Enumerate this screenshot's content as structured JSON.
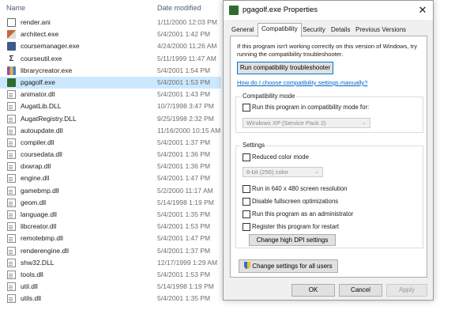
{
  "explorer": {
    "columns": {
      "name": "Name",
      "date": "Date modified"
    },
    "files": [
      {
        "name": "render.ani",
        "date": "1/11/2000 12:03 PM",
        "icon": "ani-file-icon"
      },
      {
        "name": "architect.exe",
        "date": "5/4/2001 1:42 PM",
        "icon": "architect-app-icon"
      },
      {
        "name": "coursemanager.exe",
        "date": "4/24/2000 11:26 AM",
        "icon": "coursemanager-app-icon"
      },
      {
        "name": "courseutil.exe",
        "date": "5/11/1999 11:47 AM",
        "icon": "courseutil-app-icon"
      },
      {
        "name": "librarycreator.exe",
        "date": "5/4/2001 1:54 PM",
        "icon": "librarycreator-app-icon"
      },
      {
        "name": "pgagolf.exe",
        "date": "5/4/2001 1:53 PM",
        "icon": "pgagolf-app-icon",
        "selected": true
      },
      {
        "name": "animator.dll",
        "date": "5/4/2001 1:43 PM",
        "icon": "dll-file-icon"
      },
      {
        "name": "AugatLib.DLL",
        "date": "10/7/1998 3:47 PM",
        "icon": "dll-file-icon"
      },
      {
        "name": "AugatRegistry.DLL",
        "date": "9/25/1998 2:32 PM",
        "icon": "dll-file-icon"
      },
      {
        "name": "autoupdate.dll",
        "date": "11/16/2000 10:15 AM",
        "icon": "dll-file-icon"
      },
      {
        "name": "compiler.dll",
        "date": "5/4/2001 1:37 PM",
        "icon": "dll-file-icon"
      },
      {
        "name": "coursedata.dll",
        "date": "5/4/2001 1:36 PM",
        "icon": "dll-file-icon"
      },
      {
        "name": "dxwrap.dll",
        "date": "5/4/2001 1:36 PM",
        "icon": "dll-file-icon"
      },
      {
        "name": "engine.dll",
        "date": "5/4/2001 1:47 PM",
        "icon": "dll-file-icon"
      },
      {
        "name": "gamebmp.dll",
        "date": "5/2/2000 11:17 AM",
        "icon": "dll-file-icon"
      },
      {
        "name": "geom.dll",
        "date": "5/14/1998 1:19 PM",
        "icon": "dll-file-icon"
      },
      {
        "name": "language.dll",
        "date": "5/4/2001 1:35 PM",
        "icon": "dll-file-icon"
      },
      {
        "name": "libcreator.dll",
        "date": "5/4/2001 1:53 PM",
        "icon": "dll-file-icon"
      },
      {
        "name": "remotebmp.dll",
        "date": "5/4/2001 1:47 PM",
        "icon": "dll-file-icon"
      },
      {
        "name": "renderengine.dll",
        "date": "5/4/2001 1:37 PM",
        "icon": "dll-file-icon"
      },
      {
        "name": "shw32.DLL",
        "date": "12/17/1999 1:29 AM",
        "icon": "dll-file-icon"
      },
      {
        "name": "tools.dll",
        "date": "5/4/2001 1:53 PM",
        "icon": "dll-file-icon"
      },
      {
        "name": "util.dll",
        "date": "5/14/1998 1:19 PM",
        "icon": "dll-file-icon"
      },
      {
        "name": "utils.dll",
        "date": "5/4/2001 1:35 PM",
        "icon": "dll-file-icon"
      }
    ]
  },
  "dialog": {
    "title": "pgagolf.exe Properties",
    "close_label": "✕",
    "tabs": [
      "General",
      "Compatibility",
      "Security",
      "Details",
      "Previous Versions"
    ],
    "active_tab": "Compatibility",
    "intro_text": "If this program isn't working correctly on this version of Windows, try running the compatibility troubleshooter.",
    "troubleshooter_button": "Run compatibility troubleshooter",
    "help_link": "How do I choose compatibility settings manually?",
    "compat_mode": {
      "label": "Compatibility mode",
      "checkbox": "Run this program in compatibility mode for:",
      "checked": false,
      "select_value": "Windows XP (Service Pack 2)"
    },
    "settings": {
      "label": "Settings",
      "reduced_color": "Reduced color mode",
      "color_select": "8-bit (256) color",
      "res_640": "Run in 640 x 480 screen resolution",
      "disable_fullscreen": "Disable fullscreen optimizations",
      "run_admin": "Run this program as an administrator",
      "register_restart": "Register this program for restart",
      "high_dpi_button": "Change high DPI settings"
    },
    "all_users_button": "Change settings for all users",
    "ok_button": "OK",
    "cancel_button": "Cancel",
    "apply_button": "Apply"
  }
}
